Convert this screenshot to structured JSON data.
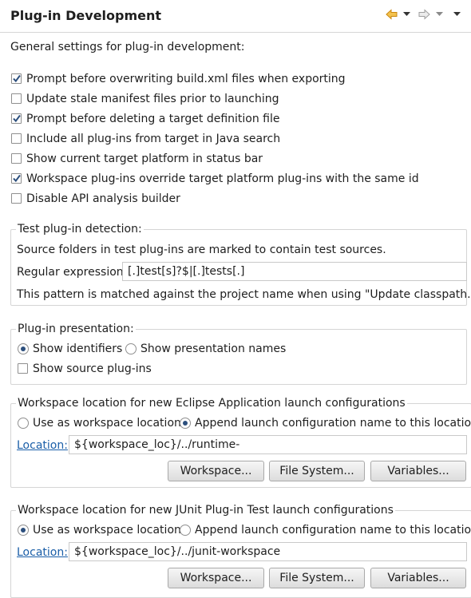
{
  "page": {
    "title": "Plug-in Development",
    "intro": "General settings for plug-in development:"
  },
  "general": {
    "options": [
      {
        "label": "Prompt before overwriting build.xml files when exporting",
        "checked": true
      },
      {
        "label": "Update stale manifest files prior to launching",
        "checked": false
      },
      {
        "label": "Prompt before deleting a target definition file",
        "checked": true
      },
      {
        "label": "Include all plug-ins from target in Java search",
        "checked": false
      },
      {
        "label": "Show current target platform in status bar",
        "checked": false
      },
      {
        "label": "Workspace plug-ins override target platform plug-ins with the same id",
        "checked": true
      },
      {
        "label": "Disable API analysis builder",
        "checked": false
      }
    ]
  },
  "test_detection": {
    "legend": "Test plug-in detection:",
    "description": "Source folders in test plug-ins are marked to contain test sources.",
    "regex_label": "Regular expression:",
    "regex_value": "[.]test[s]?$|[.]tests[.]",
    "note": "This pattern is matched against the project name when using \"Update classpath...\"."
  },
  "presentation": {
    "legend": "Plug-in presentation:",
    "show_identifiers": "Show identifiers",
    "show_presentation_names": "Show presentation names",
    "selected": "Show identifiers",
    "show_source": "Show source plug-ins",
    "show_source_checked": false
  },
  "eclipse_app": {
    "legend": "Workspace location for new Eclipse Application launch configurations",
    "use_as_workspace": "Use as workspace location",
    "append_name": "Append launch configuration name to this location",
    "selected": "Append launch configuration name to this location",
    "location_label": "Location:",
    "location_value": "${workspace_loc}/../runtime-",
    "workspace_btn": "Workspace...",
    "filesystem_btn": "File System...",
    "variables_btn": "Variables..."
  },
  "junit": {
    "legend": "Workspace location for new JUnit Plug-in Test launch configurations",
    "use_as_workspace": "Use as workspace location",
    "append_name": "Append launch configuration name to this location",
    "selected": "Use as workspace location",
    "location_label": "Location:",
    "location_value": "${workspace_loc}/../junit-workspace",
    "workspace_btn": "Workspace...",
    "filesystem_btn": "File System...",
    "variables_btn": "Variables..."
  },
  "toolbar": {
    "icons": [
      "back-arrow-icon",
      "back-dropdown-icon",
      "forward-arrow-icon",
      "forward-dropdown-icon",
      "view-menu-icon"
    ]
  },
  "colors": {
    "accent": "#2c4f7d",
    "back_arrow": "#e7a21a",
    "link": "#1a5ea8"
  }
}
